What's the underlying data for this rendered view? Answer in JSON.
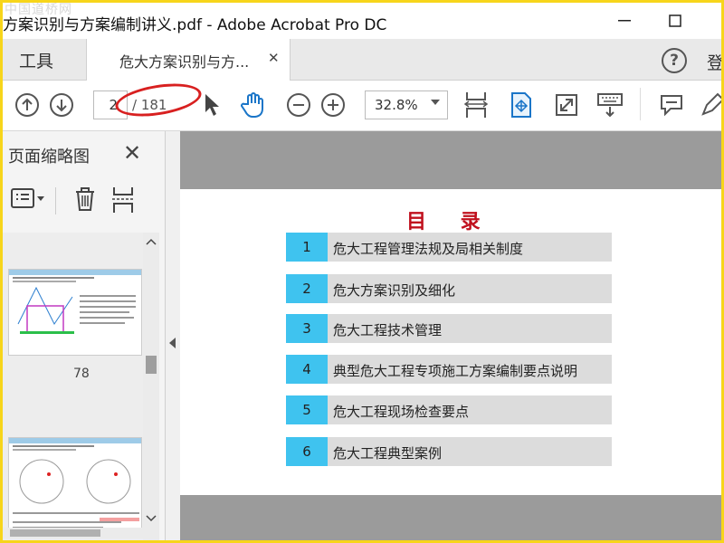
{
  "window": {
    "title": "方案识别与方案编制讲义.pdf - Adobe Acrobat Pro DC",
    "watermark": "中国道桥网"
  },
  "tabs": {
    "tools_label": "工具",
    "doc_tab_label": "危大方案识别与方...",
    "signin_label": "登"
  },
  "toolbar": {
    "current_page": "2",
    "total_pages": "/ 181",
    "zoom": "32.8%"
  },
  "left_panel": {
    "title": "页面缩略图",
    "thumbnails": [
      {
        "page_label": "78"
      },
      {
        "page_label": ""
      }
    ]
  },
  "document": {
    "toc_title": "目 录",
    "toc_items": [
      {
        "num": "1",
        "text": "危大工程管理法规及局相关制度"
      },
      {
        "num": "2",
        "text": "危大方案识别及细化"
      },
      {
        "num": "3",
        "text": "危大工程技术管理"
      },
      {
        "num": "4",
        "text": "典型危大工程专项施工方案编制要点说明"
      },
      {
        "num": "5",
        "text": "危大工程现场检查要点"
      },
      {
        "num": "6",
        "text": "危大工程典型案例"
      }
    ]
  },
  "colors": {
    "accent_blue": "#3fc3ef",
    "toc_title_red": "#c0101d",
    "highlight_red": "#d82020",
    "frame_yellow": "#f7d51b"
  }
}
